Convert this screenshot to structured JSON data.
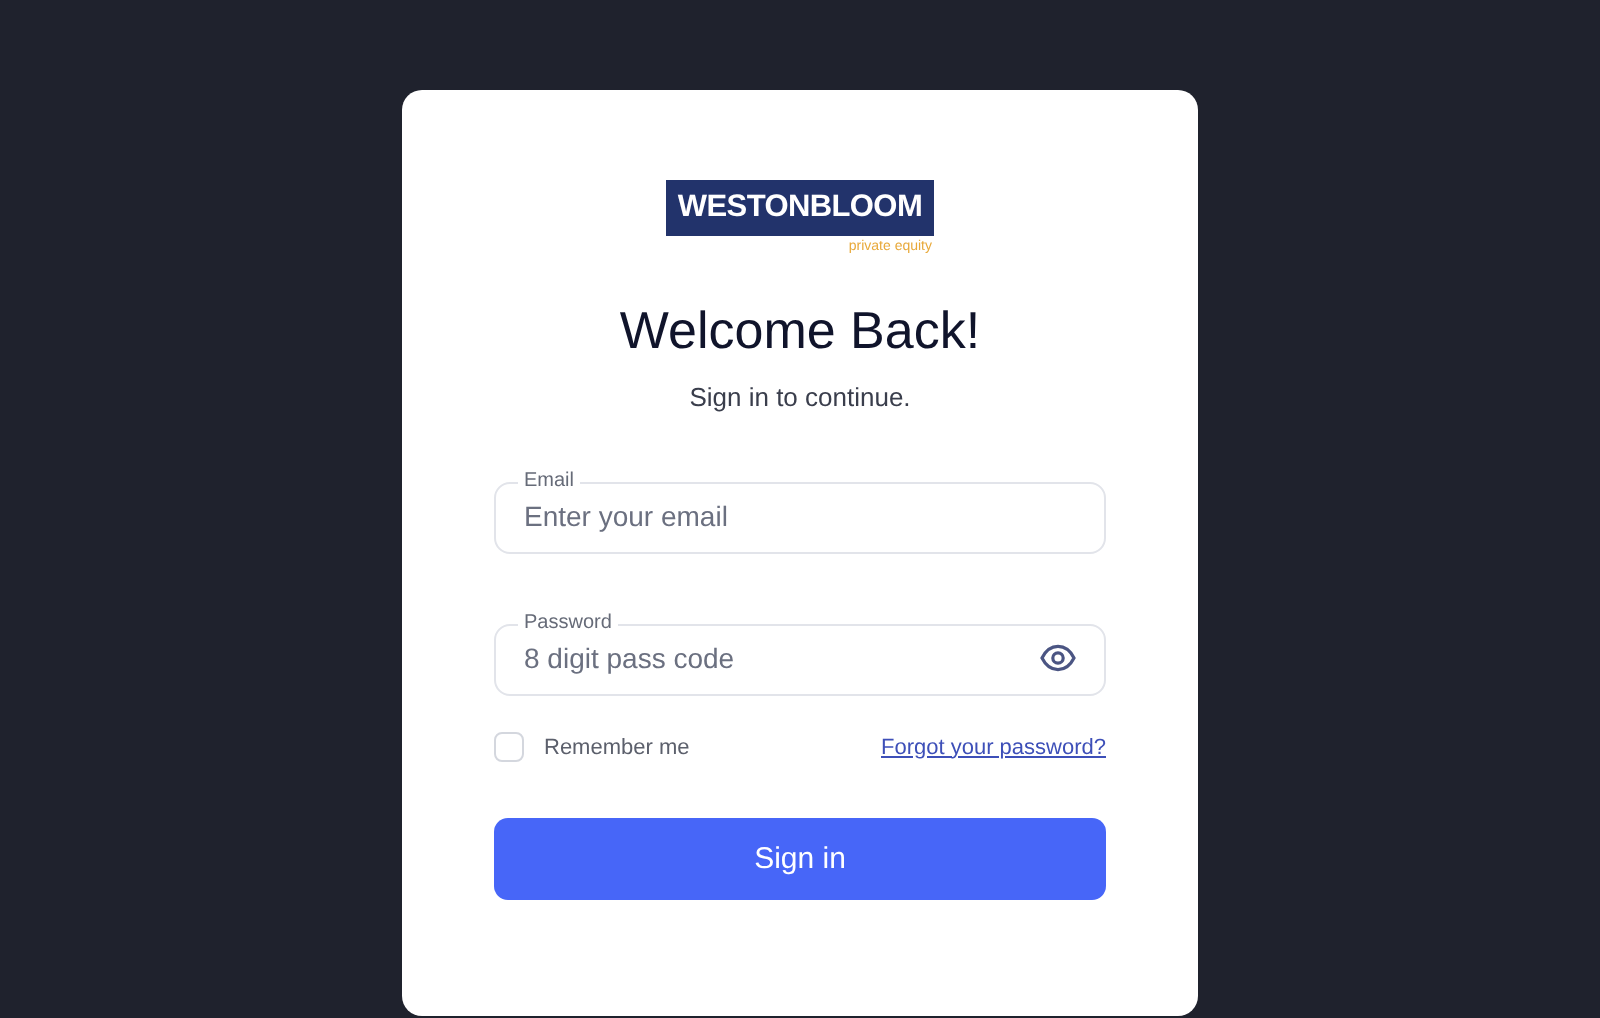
{
  "logo": {
    "name": "WESTONBLOOM",
    "tagline": "private equity"
  },
  "title": "Welcome Back!",
  "subtitle": "Sign in to continue.",
  "fields": [
    {
      "kind": "email",
      "label": "Email",
      "placeholder": "Enter your email"
    },
    {
      "kind": "password",
      "label": "Password",
      "placeholder": "8 digit pass code"
    }
  ],
  "remember": {
    "label": "Remember me",
    "checked": false
  },
  "forgot_link": "Forgot your password?",
  "submit_button": "Sign in"
}
